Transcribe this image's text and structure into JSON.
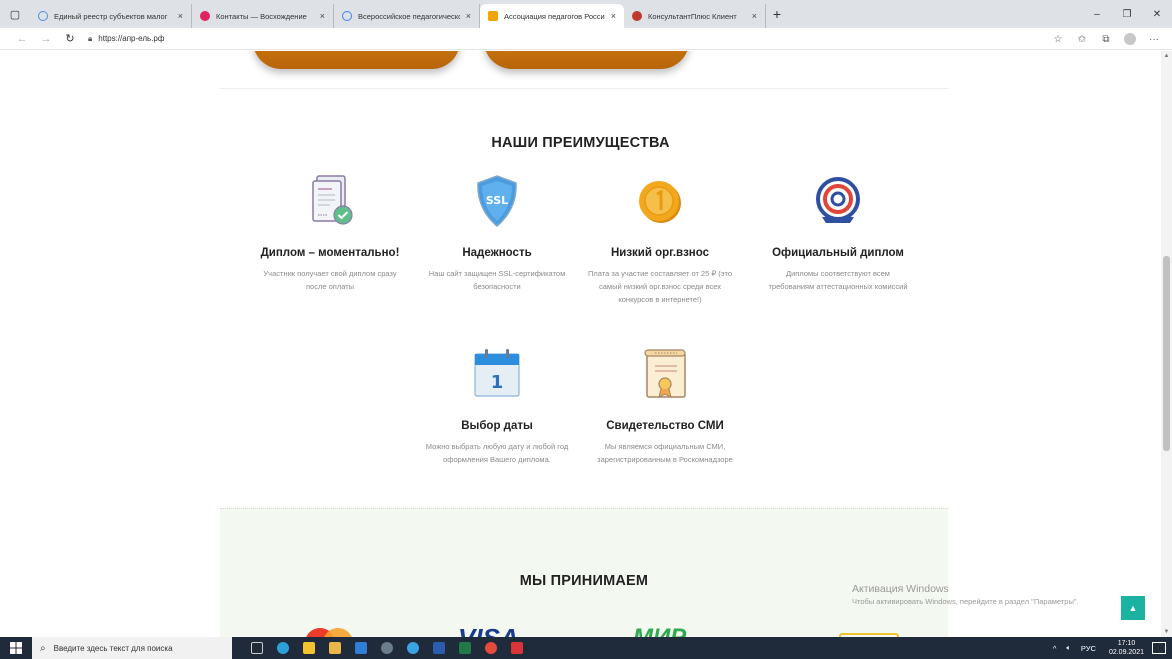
{
  "browser": {
    "tabs": [
      {
        "title": "Единый реестр субъектов малог",
        "favicon_color": "#4a90d9",
        "active": false
      },
      {
        "title": "Контакты — Восхождение",
        "favicon_color": "#e0245e",
        "active": false
      },
      {
        "title": "Всероссийское педагогическое",
        "favicon_color": "#3b82f6",
        "active": false
      },
      {
        "title": "Ассоциация педагогов России",
        "favicon_color": "#f0a500",
        "active": true
      },
      {
        "title": "КонсультантПлюс Клиент",
        "favicon_color": "#c0392b",
        "active": false
      }
    ],
    "tab_close": "×",
    "new_tab": "+",
    "window_controls": {
      "minimize": "–",
      "restore": "❐",
      "close": "✕"
    },
    "url": "https://апр-ель.рф"
  },
  "page": {
    "advantages_title": "НАШИ ПРЕИМУЩЕСТВА",
    "features": [
      {
        "icon": "diploma-check-icon",
        "title": "Диплом – моментально!",
        "desc": "Участник получает свой диплом сразу после оплаты"
      },
      {
        "icon": "ssl-shield-icon",
        "title": "Надежность",
        "desc": "Наш сайт защищен SSL-сертификатом безопасности"
      },
      {
        "icon": "coin-icon",
        "title": "Низкий орг.взнос",
        "desc": "Плата за участие составляет от 25 ₽ (это самый низкий орг.взнос среди всех конкурсов в интернете!)"
      },
      {
        "icon": "official-seal-icon",
        "title": "Официальный диплом",
        "desc": "Дипломы соответствуют всем требованиям аттестационных комиссий"
      },
      {
        "icon": "calendar-icon",
        "title": "Выбор даты",
        "desc": "Можно выбрать любую дату и любой год оформления Вашего диплома."
      },
      {
        "icon": "certificate-icon",
        "title": "Свидетельство СМИ",
        "desc": "Мы являемся официальным СМИ, зарегистрированным в Роскомнадзоре"
      }
    ],
    "calendar_day": "1",
    "ssl_text": "SSL",
    "accept_title": "МЫ ПРИНИМАЕМ",
    "visa_text": "VISA",
    "mir_text": "МИР"
  },
  "windows": {
    "activation_title": "Активация Windows",
    "activation_sub": "Чтобы активировать Windows, перейдите в раздел \"Параметры\".",
    "taskbar_search": "Введите здесь текст для поиска",
    "tray_lang": "РУС",
    "tray_time": "17:10",
    "tray_date": "02.09.2021"
  },
  "colors": {
    "accent_teal": "#1ab3a1",
    "accept_bg": "#f3f8f0",
    "taskbar": "#1f2a3a"
  }
}
